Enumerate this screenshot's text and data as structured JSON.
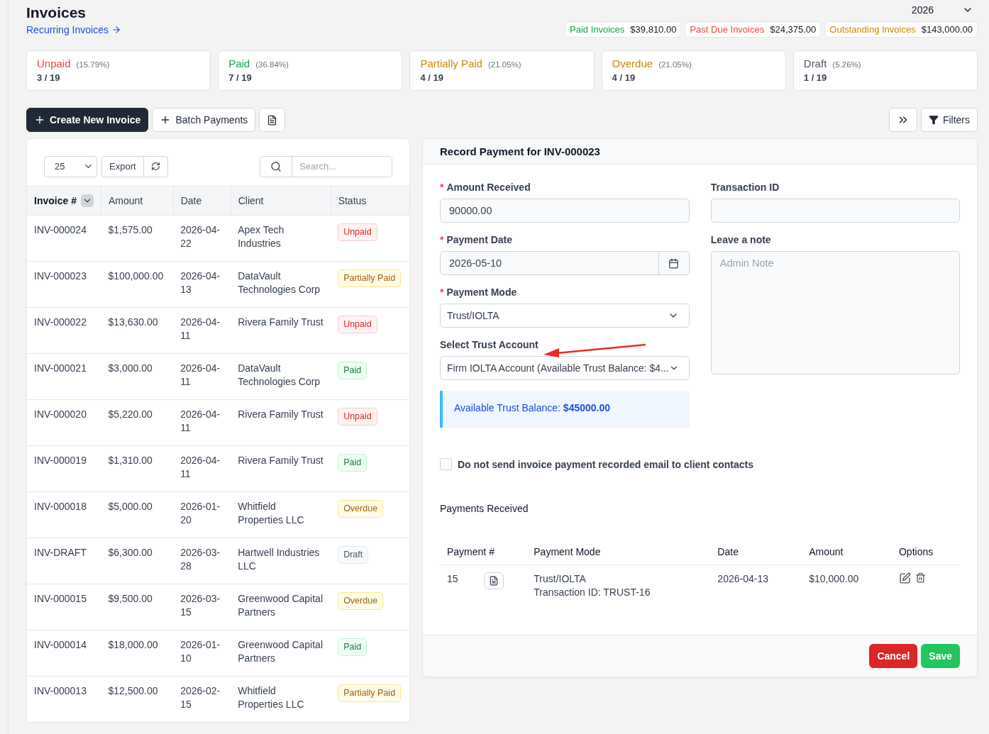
{
  "header": {
    "title": "Invoices",
    "link": "Recurring Invoices",
    "year": "2026"
  },
  "totals": [
    {
      "kind": "paid",
      "label": "Paid Invoices",
      "amount": "$39,810.00"
    },
    {
      "kind": "overdue",
      "label": "Past Due Invoices",
      "amount": "$24,375.00"
    },
    {
      "kind": "outstanding",
      "label": "Outstanding Invoices",
      "amount": "$143,000.00"
    }
  ],
  "status_cards": [
    {
      "kind": "unpaid",
      "label": "Unpaid",
      "percent": "(15.79%)",
      "count": "3 / 19"
    },
    {
      "kind": "paid",
      "label": "Paid",
      "percent": "(36.84%)",
      "count": "7 / 19"
    },
    {
      "kind": "partial",
      "label": "Partially Paid",
      "percent": "(21.05%)",
      "count": "4 / 19"
    },
    {
      "kind": "outstanding",
      "label": "Overdue",
      "percent": "(21.05%)",
      "count": "4 / 19"
    },
    {
      "kind": "draft",
      "label": "Draft",
      "percent": "(5.26%)",
      "count": "1 / 19"
    }
  ],
  "toolbar": {
    "create": "Create New Invoice",
    "batch": "Batch Payments",
    "filters": "Filters"
  },
  "table": {
    "page_size": "25",
    "export": "Export",
    "search_placeholder": "Search...",
    "columns": [
      "Invoice #",
      "Amount",
      "Date",
      "Client",
      "Status"
    ],
    "rows": [
      {
        "number": "INV-000024",
        "amount": "$1,575.00",
        "date": "2026-04-22",
        "client": "Apex Tech Industries",
        "status": "Unpaid",
        "kind": "unpaid"
      },
      {
        "number": "INV-000023",
        "amount": "$100,000.00",
        "date": "2026-04-13",
        "client": "DataVault Technologies Corp",
        "status": "Partially Paid",
        "kind": "partial"
      },
      {
        "number": "INV-000022",
        "amount": "$13,630.00",
        "date": "2026-04-11",
        "client": "Rivera Family Trust",
        "status": "Unpaid",
        "kind": "unpaid"
      },
      {
        "number": "INV-000021",
        "amount": "$3,000.00",
        "date": "2026-04-11",
        "client": "DataVault Technologies Corp",
        "status": "Paid",
        "kind": "paid"
      },
      {
        "number": "INV-000020",
        "amount": "$5,220.00",
        "date": "2026-04-11",
        "client": "Rivera Family Trust",
        "status": "Unpaid",
        "kind": "unpaid"
      },
      {
        "number": "INV-000019",
        "amount": "$1,310.00",
        "date": "2026-04-11",
        "client": "Rivera Family Trust",
        "status": "Paid",
        "kind": "paid"
      },
      {
        "number": "INV-000018",
        "amount": "$5,000.00",
        "date": "2026-01-20",
        "client": "Whitfield Properties LLC",
        "status": "Overdue",
        "kind": "overdue"
      },
      {
        "number": "INV-DRAFT",
        "amount": "$6,300.00",
        "date": "2026-03-28",
        "client": "Hartwell Industries LLC",
        "status": "Draft",
        "kind": "draft"
      },
      {
        "number": "INV-000015",
        "amount": "$9,500.00",
        "date": "2026-03-15",
        "client": "Greenwood Capital Partners",
        "status": "Overdue",
        "kind": "overdue"
      },
      {
        "number": "INV-000014",
        "amount": "$18,000.00",
        "date": "2026-01-10",
        "client": "Greenwood Capital Partners",
        "status": "Paid",
        "kind": "paid"
      },
      {
        "number": "INV-000013",
        "amount": "$12,500.00",
        "date": "2026-02-15",
        "client": "Whitfield Properties LLC",
        "status": "Partially Paid",
        "kind": "partial"
      }
    ]
  },
  "payment_form": {
    "title": "Record Payment for INV-000023",
    "required_mark": "*",
    "amount_required": true,
    "date_required": true,
    "mode_required": true,
    "amount_label": "Amount Received",
    "amount_value": "90000.00",
    "transaction_label": "Transaction ID",
    "date_label": "Payment Date",
    "date_value": "2026-05-10",
    "note_label": "Leave a note",
    "note_placeholder": "Admin Note",
    "mode_label": "Payment Mode",
    "mode_value": "Trust/IOLTA",
    "trust_label": "Select Trust Account",
    "trust_value": "Firm IOLTA Account (Available Trust Balance: $4...",
    "balance_text": "Available Trust Balance:",
    "balance_amount": "$45000.00",
    "no_email": {
      "label": "Do not send invoice payment recorded email to client contacts",
      "checked": false
    },
    "payments_title": "Payments Received",
    "payment_columns": [
      "Payment #",
      "Payment Mode",
      "Date",
      "Amount",
      "Options"
    ],
    "payments": [
      {
        "number": "15",
        "mode": "Trust/IOLTA",
        "transaction": "Transaction ID: TRUST-16",
        "date": "2026-04-13",
        "amount": "$10,000.00"
      }
    ],
    "cancel": "Cancel",
    "save": "Save"
  }
}
